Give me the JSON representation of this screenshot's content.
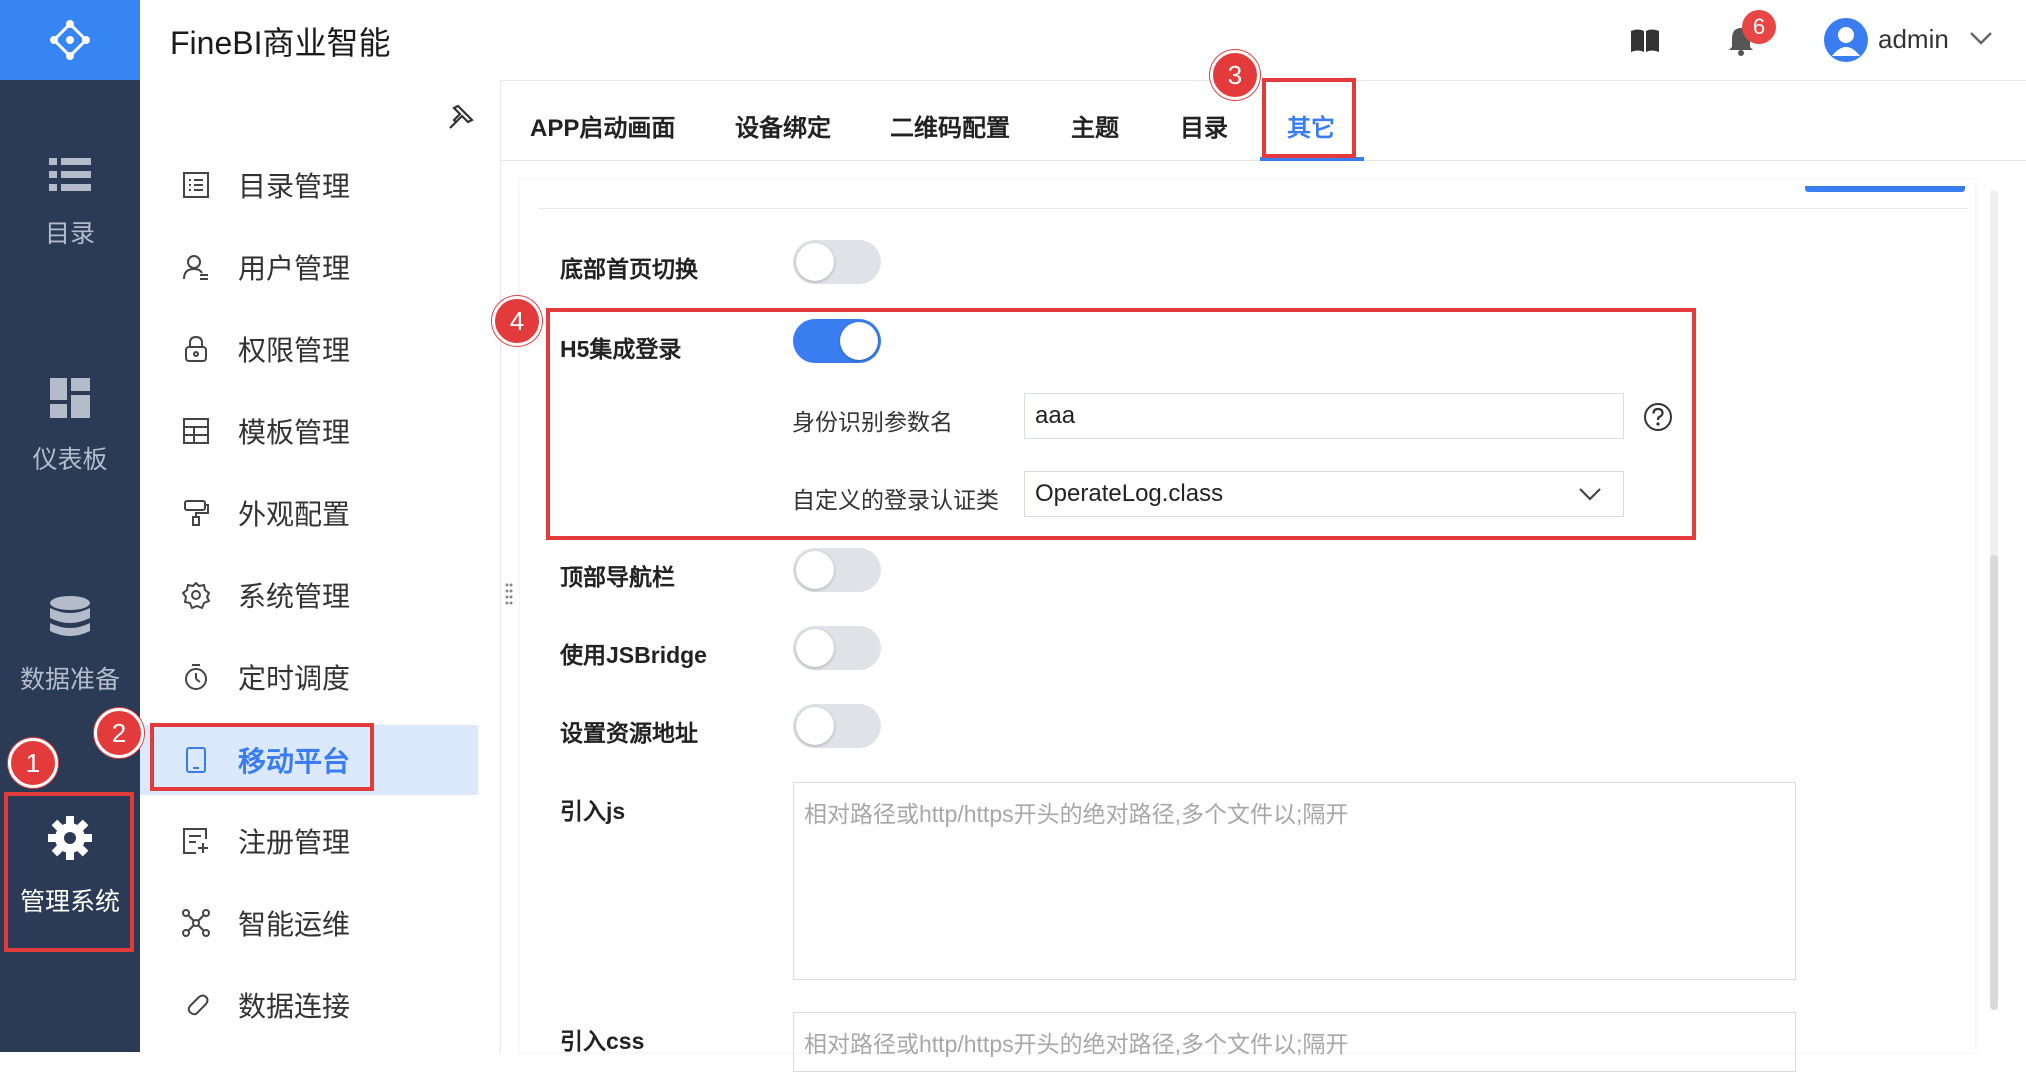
{
  "app": {
    "title": "FineBI商业智能"
  },
  "header": {
    "notification_count": "6",
    "user_name": "admin"
  },
  "nav": {
    "items": [
      {
        "label": "目录",
        "icon": "list-icon"
      },
      {
        "label": "仪表板",
        "icon": "dashboard-icon"
      },
      {
        "label": "数据准备",
        "icon": "database-icon"
      },
      {
        "label": "管理系统",
        "icon": "gear-icon"
      }
    ]
  },
  "menu": {
    "items": [
      {
        "label": "目录管理",
        "icon": "catalog-icon"
      },
      {
        "label": "用户管理",
        "icon": "user-icon"
      },
      {
        "label": "权限管理",
        "icon": "lock-icon"
      },
      {
        "label": "模板管理",
        "icon": "template-icon"
      },
      {
        "label": "外观配置",
        "icon": "paint-icon"
      },
      {
        "label": "系统管理",
        "icon": "settings-icon"
      },
      {
        "label": "定时调度",
        "icon": "timer-icon"
      },
      {
        "label": "移动平台",
        "icon": "tablet-icon"
      },
      {
        "label": "注册管理",
        "icon": "register-icon"
      },
      {
        "label": "智能运维",
        "icon": "network-icon"
      },
      {
        "label": "数据连接",
        "icon": "link-icon"
      }
    ],
    "active": "移动平台"
  },
  "tabs": [
    "APP启动画面",
    "设备绑定",
    "二维码配置",
    "主题",
    "目录",
    "其它"
  ],
  "active_tab": "其它",
  "settings": {
    "bottom_switch": {
      "label": "底部首页切换",
      "on": false
    },
    "h5_login": {
      "label": "H5集成登录",
      "on": true,
      "param_label": "身份识别参数名",
      "param_value": "aaa",
      "class_label": "自定义的登录认证类",
      "class_value": "OperateLog.class"
    },
    "top_nav": {
      "label": "顶部导航栏",
      "on": false
    },
    "jsbridge": {
      "label": "使用JSBridge",
      "on": false
    },
    "resource": {
      "label": "设置资源地址",
      "on": false
    },
    "import_js": {
      "label": "引入js",
      "placeholder": "相对路径或http/https开头的绝对路径,多个文件以;隔开"
    },
    "import_css": {
      "label": "引入css",
      "placeholder": "相对路径或http/https开头的绝对路径,多个文件以;隔开"
    }
  },
  "annotations": [
    "1",
    "2",
    "3",
    "4"
  ],
  "colors": {
    "accent": "#3a7df0",
    "nav_bg": "#2b3a55",
    "annotation": "#e33b3b"
  }
}
